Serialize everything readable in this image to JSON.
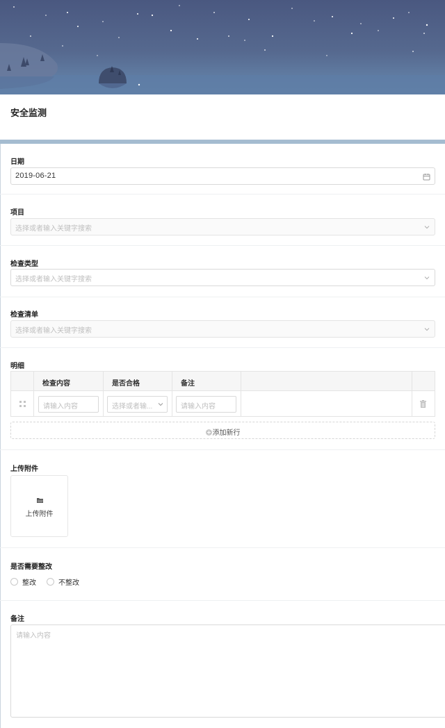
{
  "form": {
    "title": "安全监测",
    "date": {
      "label": "日期",
      "value": "2019-06-21",
      "icon": "calendar-icon"
    },
    "project": {
      "label": "项目",
      "placeholder": "选择或者输入关键字搜索"
    },
    "check_type": {
      "label": "检查类型",
      "placeholder": "选择或者输入关键字搜索"
    },
    "checklist": {
      "label": "检查清单",
      "placeholder": "选择或者输入关键字搜索"
    },
    "details": {
      "label": "明细",
      "columns": [
        "检查内容",
        "是否合格",
        "备注"
      ],
      "row": {
        "content_placeholder": "请输入内容",
        "qualified_placeholder": "选择或者输...",
        "remark_placeholder": "请输入内容"
      },
      "add_row_label": "添加新行"
    },
    "attachment": {
      "label": "上传附件",
      "button_label": "上传附件"
    },
    "rectify": {
      "label": "是否需要整改",
      "options": [
        "整改",
        "不整改"
      ]
    },
    "remark": {
      "label": "备注",
      "placeholder": "请输入内容"
    }
  },
  "colors": {
    "banner_top": "#4a5880",
    "banner_bottom": "#6585aa",
    "title_bar": "#a5bcd0",
    "border": "#d9d9d9",
    "placeholder": "#bfbfbf"
  }
}
